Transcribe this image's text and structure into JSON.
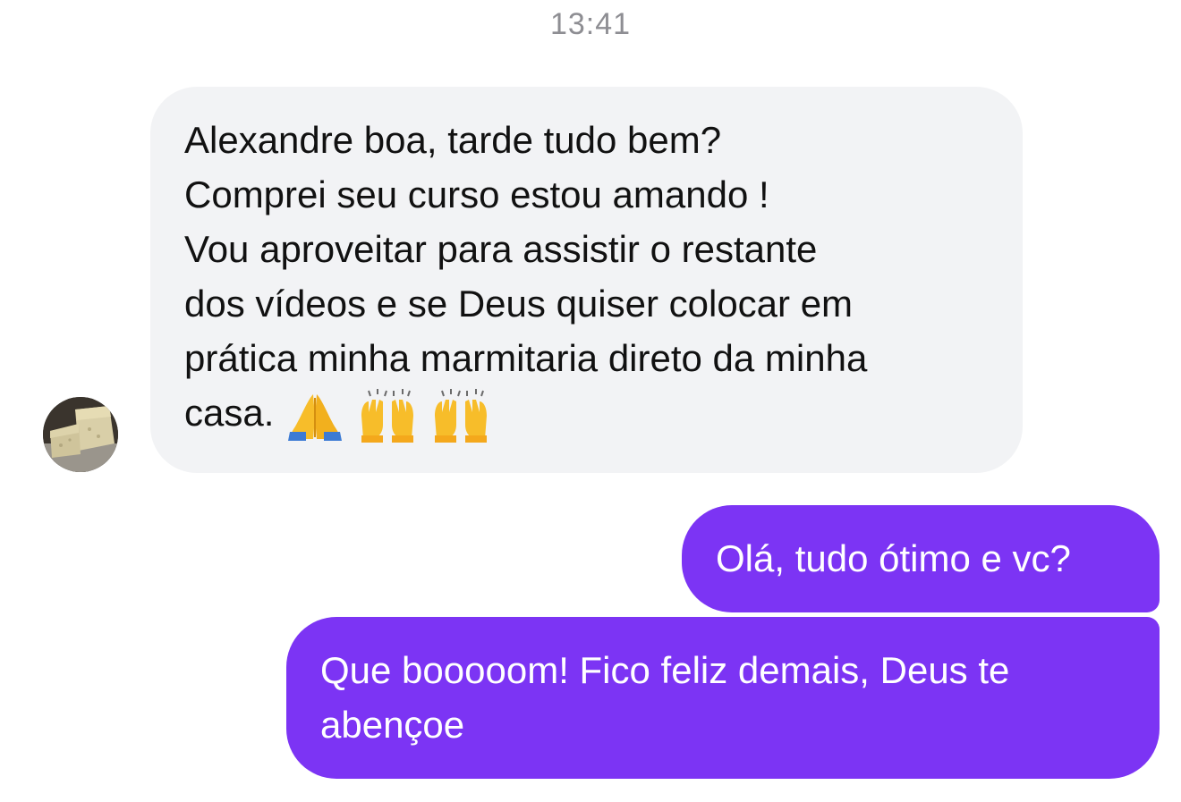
{
  "header": {
    "timestamp": "13:41"
  },
  "contact": {
    "avatar_icon": "cake-photo-avatar"
  },
  "messages": {
    "incoming": {
      "lines": [
        "Alexandre boa, tarde tudo bem?",
        "Comprei seu curso estou amando !",
        "Vou aproveitar para assistir o restante",
        "dos vídeos e se Deus quiser colocar em",
        "prática minha marmitaria direto da minha",
        "casa."
      ],
      "emojis": [
        "🙏",
        "🙌",
        "🙌"
      ],
      "bubble_color": "#f2f3f5",
      "text_color": "#111111"
    },
    "outgoing": [
      {
        "text": "Olá, tudo ótimo e vc?"
      },
      {
        "lines": [
          "Que booooom! Fico feliz demais, Deus te",
          "abençoe"
        ]
      }
    ],
    "outgoing_bubble_color": "#7c34f4",
    "outgoing_text_color": "#ffffff"
  }
}
